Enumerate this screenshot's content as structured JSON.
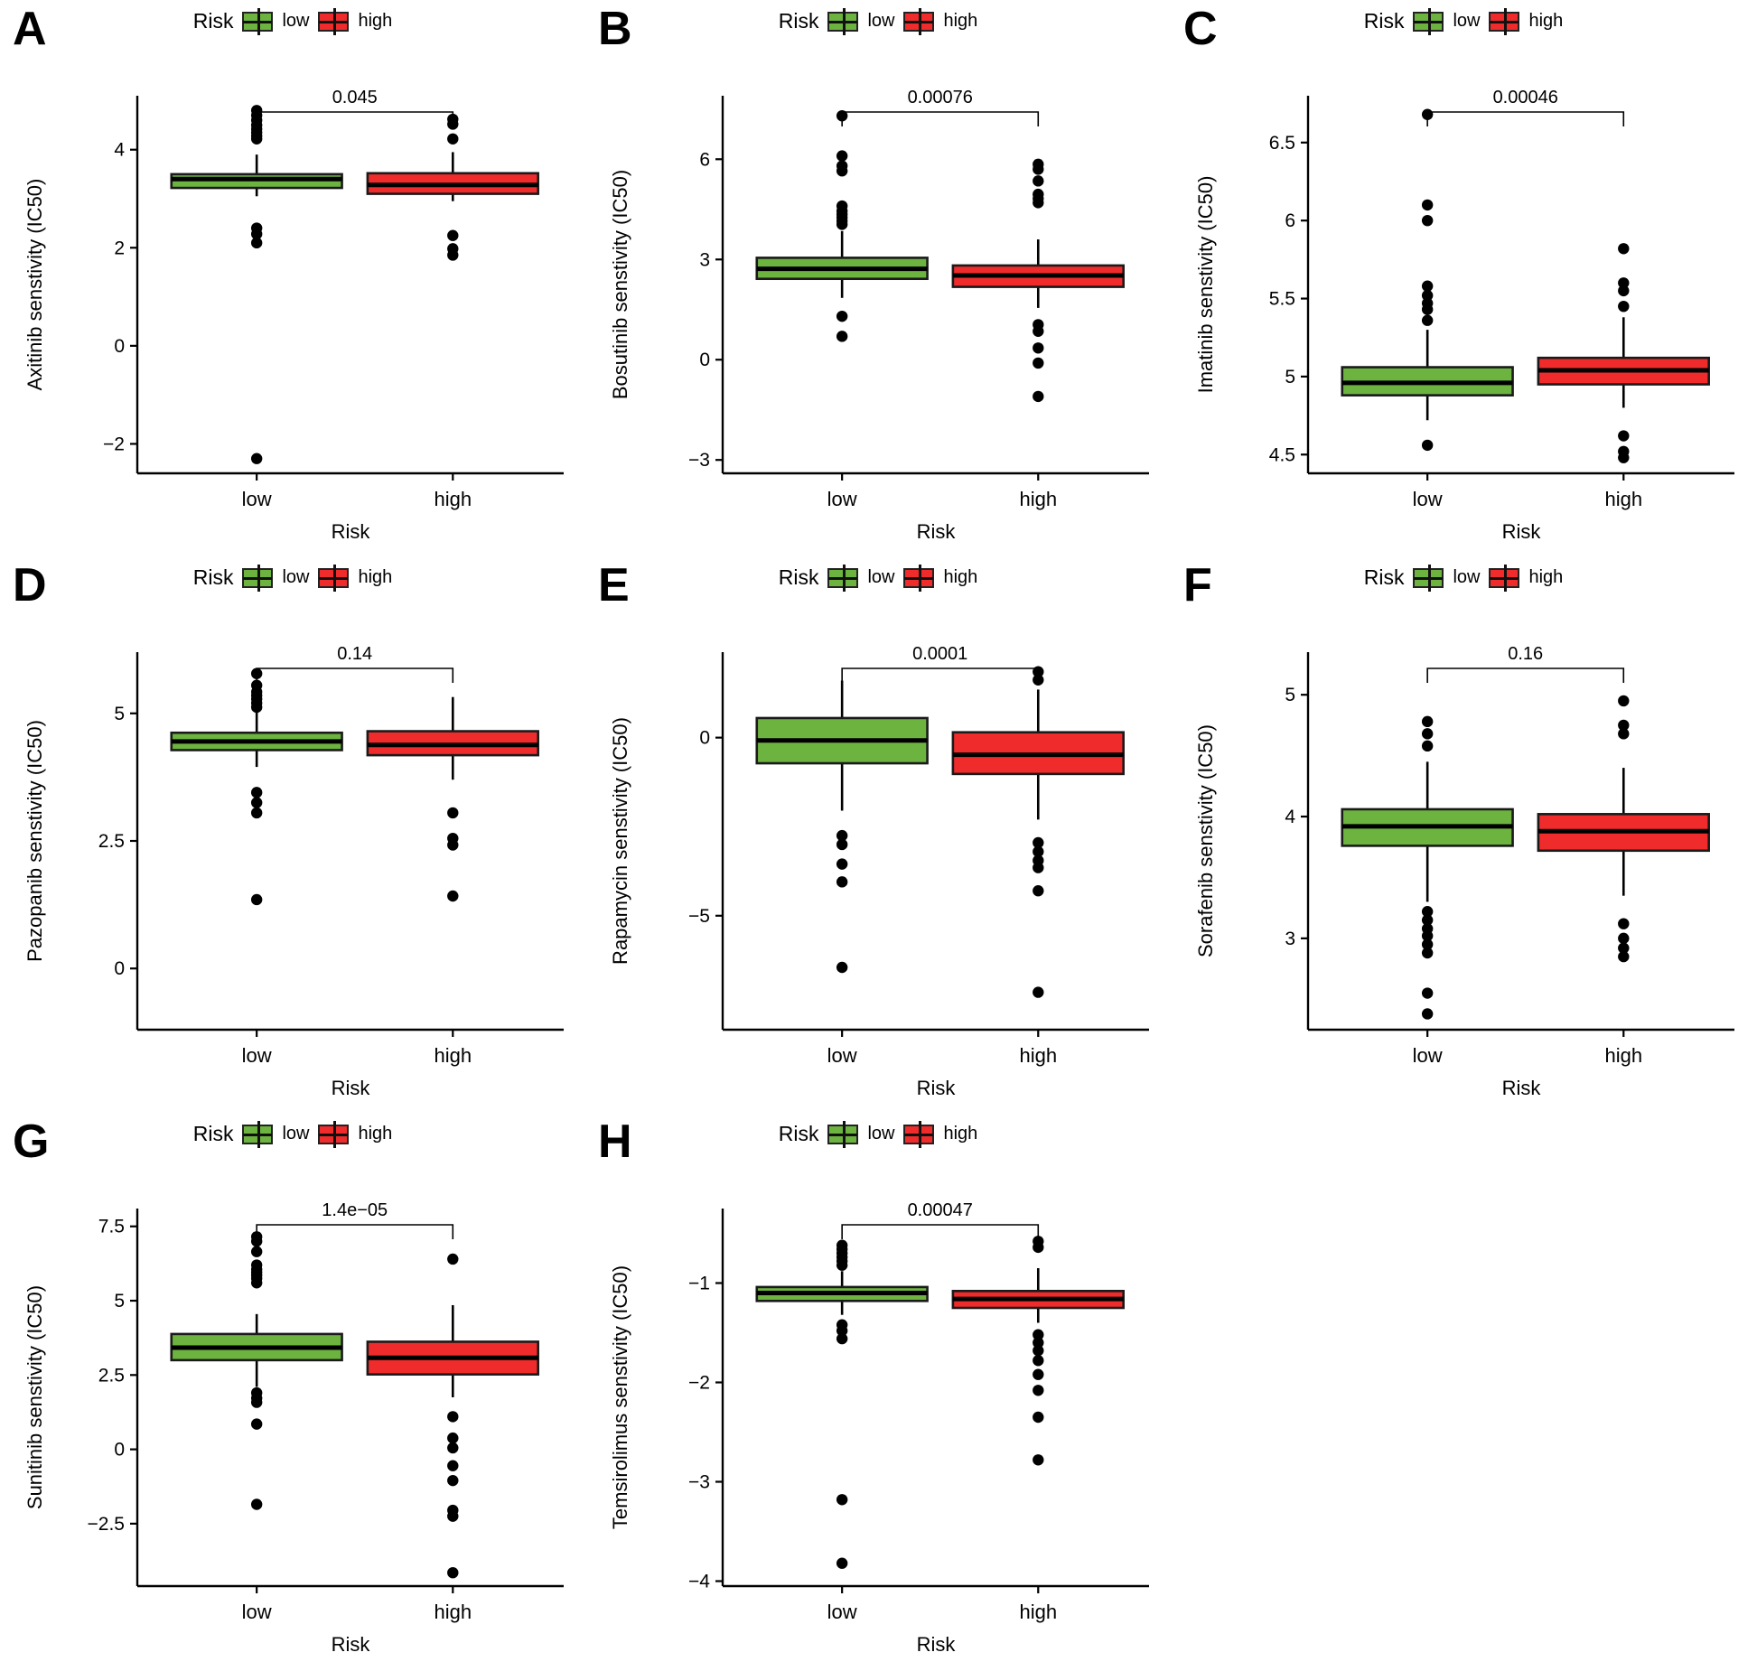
{
  "figure": {
    "legend_title": "Risk",
    "legend_items": [
      {
        "label": "low",
        "color": "#6cb33f"
      },
      {
        "label": "high",
        "color": "#ef2b2b"
      }
    ],
    "x_axis_title": "Risk",
    "categories": [
      "low",
      "high"
    ]
  },
  "chart_data": [
    {
      "panel": "A",
      "type": "box",
      "title": "",
      "ylabel": "Axitinib senstivity (IC50)",
      "xlabel": "Risk",
      "categories": [
        "low",
        "high"
      ],
      "yticks": [
        -2,
        0,
        2,
        4
      ],
      "ylim": [
        -2.6,
        5.1
      ],
      "pvalue": "0.045",
      "series": [
        {
          "name": "low",
          "color": "#6cb33f",
          "min": 3.05,
          "q1": 3.22,
          "median": 3.4,
          "q3": 3.5,
          "max": 3.9,
          "outliers": [
            4.8,
            4.7,
            4.6,
            4.5,
            4.42,
            4.35,
            4.28,
            4.22,
            2.4,
            2.28,
            2.1,
            -2.3
          ]
        },
        {
          "name": "high",
          "color": "#ef2b2b",
          "min": 2.95,
          "q1": 3.1,
          "median": 3.28,
          "q3": 3.52,
          "max": 3.95,
          "outliers": [
            4.62,
            4.52,
            4.22,
            2.25,
            1.98,
            1.85
          ]
        }
      ]
    },
    {
      "panel": "B",
      "type": "box",
      "ylabel": "Bosutinib senstivity (IC50)",
      "xlabel": "Risk",
      "categories": [
        "low",
        "high"
      ],
      "yticks": [
        -3,
        0,
        3,
        6
      ],
      "ylim": [
        -3.4,
        7.9
      ],
      "pvalue": "0.00076",
      "series": [
        {
          "name": "low",
          "color": "#6cb33f",
          "min": 1.85,
          "q1": 2.42,
          "median": 2.72,
          "q3": 3.05,
          "max": 3.85,
          "outliers": [
            7.3,
            6.1,
            5.8,
            5.65,
            4.6,
            4.45,
            4.35,
            4.25,
            4.15,
            4.05,
            1.3,
            0.7
          ]
        },
        {
          "name": "high",
          "color": "#ef2b2b",
          "min": 1.55,
          "q1": 2.18,
          "median": 2.52,
          "q3": 2.82,
          "max": 3.6,
          "outliers": [
            5.85,
            5.7,
            5.35,
            4.95,
            4.82,
            4.7,
            1.05,
            0.85,
            0.35,
            -0.1,
            -1.1
          ]
        }
      ]
    },
    {
      "panel": "C",
      "type": "box",
      "ylabel": "Imatinib senstivity (IC50)",
      "xlabel": "Risk",
      "categories": [
        "low",
        "high"
      ],
      "yticks": [
        4.5,
        5.0,
        5.5,
        6.0,
        6.5
      ],
      "ylim": [
        4.38,
        6.8
      ],
      "pvalue": "0.00046",
      "series": [
        {
          "name": "low",
          "color": "#6cb33f",
          "min": 4.72,
          "q1": 4.88,
          "median": 4.96,
          "q3": 5.06,
          "max": 5.3,
          "outliers": [
            6.68,
            6.1,
            6.0,
            5.58,
            5.52,
            5.47,
            5.43,
            5.36,
            4.56
          ]
        },
        {
          "name": "high",
          "color": "#ef2b2b",
          "min": 4.8,
          "q1": 4.95,
          "median": 5.04,
          "q3": 5.12,
          "max": 5.38,
          "outliers": [
            5.82,
            5.6,
            5.55,
            5.45,
            4.62,
            4.52,
            4.48
          ]
        }
      ]
    },
    {
      "panel": "D",
      "type": "box",
      "ylabel": "Pazopanib senstivity (IC50)",
      "xlabel": "Risk",
      "categories": [
        "low",
        "high"
      ],
      "yticks": [
        0.0,
        2.5,
        5.0
      ],
      "ylim": [
        -1.2,
        6.2
      ],
      "pvalue": "0.14",
      "series": [
        {
          "name": "low",
          "color": "#6cb33f",
          "min": 3.95,
          "q1": 4.28,
          "median": 4.45,
          "q3": 4.62,
          "max": 5.05,
          "outliers": [
            5.78,
            5.55,
            5.42,
            5.35,
            5.28,
            5.2,
            5.12,
            3.45,
            3.25,
            3.05,
            1.35
          ]
        },
        {
          "name": "high",
          "color": "#ef2b2b",
          "min": 3.7,
          "q1": 4.18,
          "median": 4.38,
          "q3": 4.65,
          "max": 5.32,
          "outliers": [
            3.05,
            2.55,
            2.42,
            1.42
          ]
        }
      ]
    },
    {
      "panel": "E",
      "type": "box",
      "ylabel": "Rapamycin senstivity (IC50)",
      "xlabel": "Risk",
      "categories": [
        "low",
        "high"
      ],
      "yticks": [
        -5,
        0
      ],
      "ylim": [
        -8.2,
        2.4
      ],
      "pvalue": "0.0001",
      "series": [
        {
          "name": "low",
          "color": "#6cb33f",
          "min": -2.05,
          "q1": -0.72,
          "median": -0.08,
          "q3": 0.55,
          "max": 1.6,
          "outliers": [
            -2.75,
            -3.0,
            -3.55,
            -4.05,
            -6.45
          ]
        },
        {
          "name": "high",
          "color": "#ef2b2b",
          "min": -2.3,
          "q1": -1.02,
          "median": -0.48,
          "q3": 0.15,
          "max": 1.35,
          "outliers": [
            1.85,
            1.62,
            -2.95,
            -3.2,
            -3.45,
            -3.65,
            -4.3,
            -7.15
          ]
        }
      ]
    },
    {
      "panel": "F",
      "type": "box",
      "ylabel": "Sorafenib senstivity (IC50)",
      "xlabel": "Risk",
      "categories": [
        "low",
        "high"
      ],
      "yticks": [
        3,
        4,
        5
      ],
      "ylim": [
        2.25,
        5.35
      ],
      "pvalue": "0.16",
      "series": [
        {
          "name": "low",
          "color": "#6cb33f",
          "min": 3.3,
          "q1": 3.76,
          "median": 3.92,
          "q3": 4.06,
          "max": 4.45,
          "outliers": [
            4.78,
            4.68,
            4.58,
            3.22,
            3.15,
            3.08,
            3.02,
            2.95,
            2.88,
            2.55,
            2.38
          ]
        },
        {
          "name": "high",
          "color": "#ef2b2b",
          "min": 3.35,
          "q1": 3.72,
          "median": 3.88,
          "q3": 4.02,
          "max": 4.4,
          "outliers": [
            4.95,
            4.75,
            4.68,
            3.12,
            3.0,
            2.92,
            2.85
          ]
        }
      ]
    },
    {
      "panel": "G",
      "type": "box",
      "ylabel": "Sunitinib senstivity (IC50)",
      "xlabel": "Risk",
      "categories": [
        "low",
        "high"
      ],
      "yticks": [
        -2.5,
        0.0,
        2.5,
        5.0,
        7.5
      ],
      "ylim": [
        -4.6,
        8.1
      ],
      "pvalue": "1.4e−05",
      "series": [
        {
          "name": "low",
          "color": "#6cb33f",
          "min": 2.1,
          "q1": 3.0,
          "median": 3.42,
          "q3": 3.88,
          "max": 4.55,
          "outliers": [
            7.15,
            7.0,
            6.65,
            6.2,
            6.05,
            5.95,
            5.85,
            5.75,
            5.6,
            1.9,
            1.72,
            1.58,
            0.85,
            -1.85
          ]
        },
        {
          "name": "high",
          "color": "#ef2b2b",
          "min": 1.75,
          "q1": 2.52,
          "median": 3.08,
          "q3": 3.62,
          "max": 4.85,
          "outliers": [
            6.4,
            1.1,
            0.38,
            0.05,
            -0.55,
            -1.05,
            -2.05,
            -2.25,
            -4.15
          ]
        }
      ]
    },
    {
      "panel": "H",
      "type": "box",
      "ylabel": "Temsirolimus senstivity (IC50)",
      "xlabel": "Risk",
      "categories": [
        "low",
        "high"
      ],
      "yticks": [
        -1,
        -2,
        -3,
        -4
      ],
      "ylim": [
        -4.05,
        -0.25
      ],
      "pvalue": "0.00047",
      "series": [
        {
          "name": "low",
          "color": "#6cb33f",
          "min": -1.32,
          "q1": -1.18,
          "median": -1.1,
          "q3": -1.04,
          "max": -0.88,
          "outliers": [
            -0.62,
            -0.66,
            -0.7,
            -0.74,
            -0.78,
            -0.82,
            -1.42,
            -1.48,
            -1.56,
            -3.18,
            -3.82
          ]
        },
        {
          "name": "high",
          "color": "#ef2b2b",
          "min": -1.4,
          "q1": -1.25,
          "median": -1.16,
          "q3": -1.08,
          "max": -0.85,
          "outliers": [
            -0.58,
            -0.64,
            -1.52,
            -1.6,
            -1.68,
            -1.78,
            -1.92,
            -2.08,
            -2.35,
            -2.78
          ]
        }
      ]
    }
  ]
}
